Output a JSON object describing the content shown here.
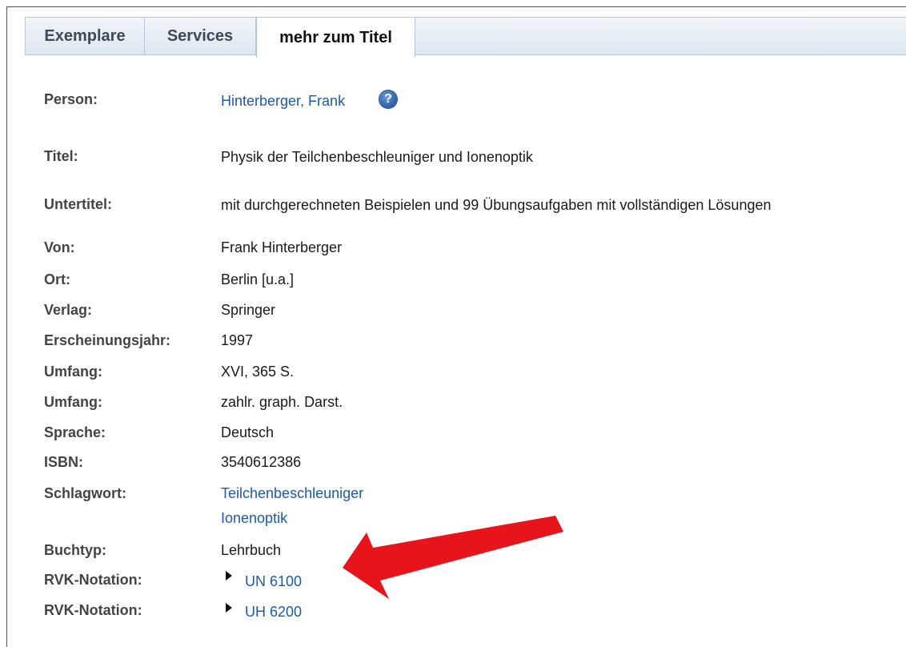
{
  "tabs": {
    "exemplare": "Exemplare",
    "services": "Services",
    "mehr": "mehr zum Titel"
  },
  "record": {
    "person_label": "Person:",
    "person_value": "Hinterberger, Frank",
    "help_icon": "?",
    "titel_label": "Titel:",
    "titel_value": "Physik der Teilchenbeschleuniger und Ionenoptik",
    "untertitel_label": "Untertitel:",
    "untertitel_value": "mit durchgerechneten Beispielen und 99 Übungsaufgaben mit vollständigen Lösungen",
    "von_label": "Von:",
    "von_value": "Frank Hinterberger",
    "ort_label": "Ort:",
    "ort_value": "Berlin [u.a.]",
    "verlag_label": "Verlag:",
    "verlag_value": "Springer",
    "jahr_label": "Erscheinungsjahr:",
    "jahr_value": "1997",
    "umfang1_label": "Umfang:",
    "umfang1_value": "XVI, 365 S.",
    "umfang2_label": "Umfang:",
    "umfang2_value": "zahlr. graph. Darst.",
    "sprache_label": "Sprache:",
    "sprache_value": "Deutsch",
    "isbn_label": "ISBN:",
    "isbn_value": "3540612386",
    "schlagwort_label": "Schlagwort:",
    "schlagwort_values": [
      "Teilchenbeschleuniger",
      "Ionenoptik"
    ],
    "buchtyp_label": "Buchtyp:",
    "buchtyp_value": "Lehrbuch",
    "rvk1_label": "RVK-Notation:",
    "rvk1_value": "UN 6100",
    "rvk2_label": "RVK-Notation:",
    "rvk2_value": "UH 6200"
  },
  "colors": {
    "link": "#1f5aa6",
    "annotation_arrow": "#e8141b"
  }
}
